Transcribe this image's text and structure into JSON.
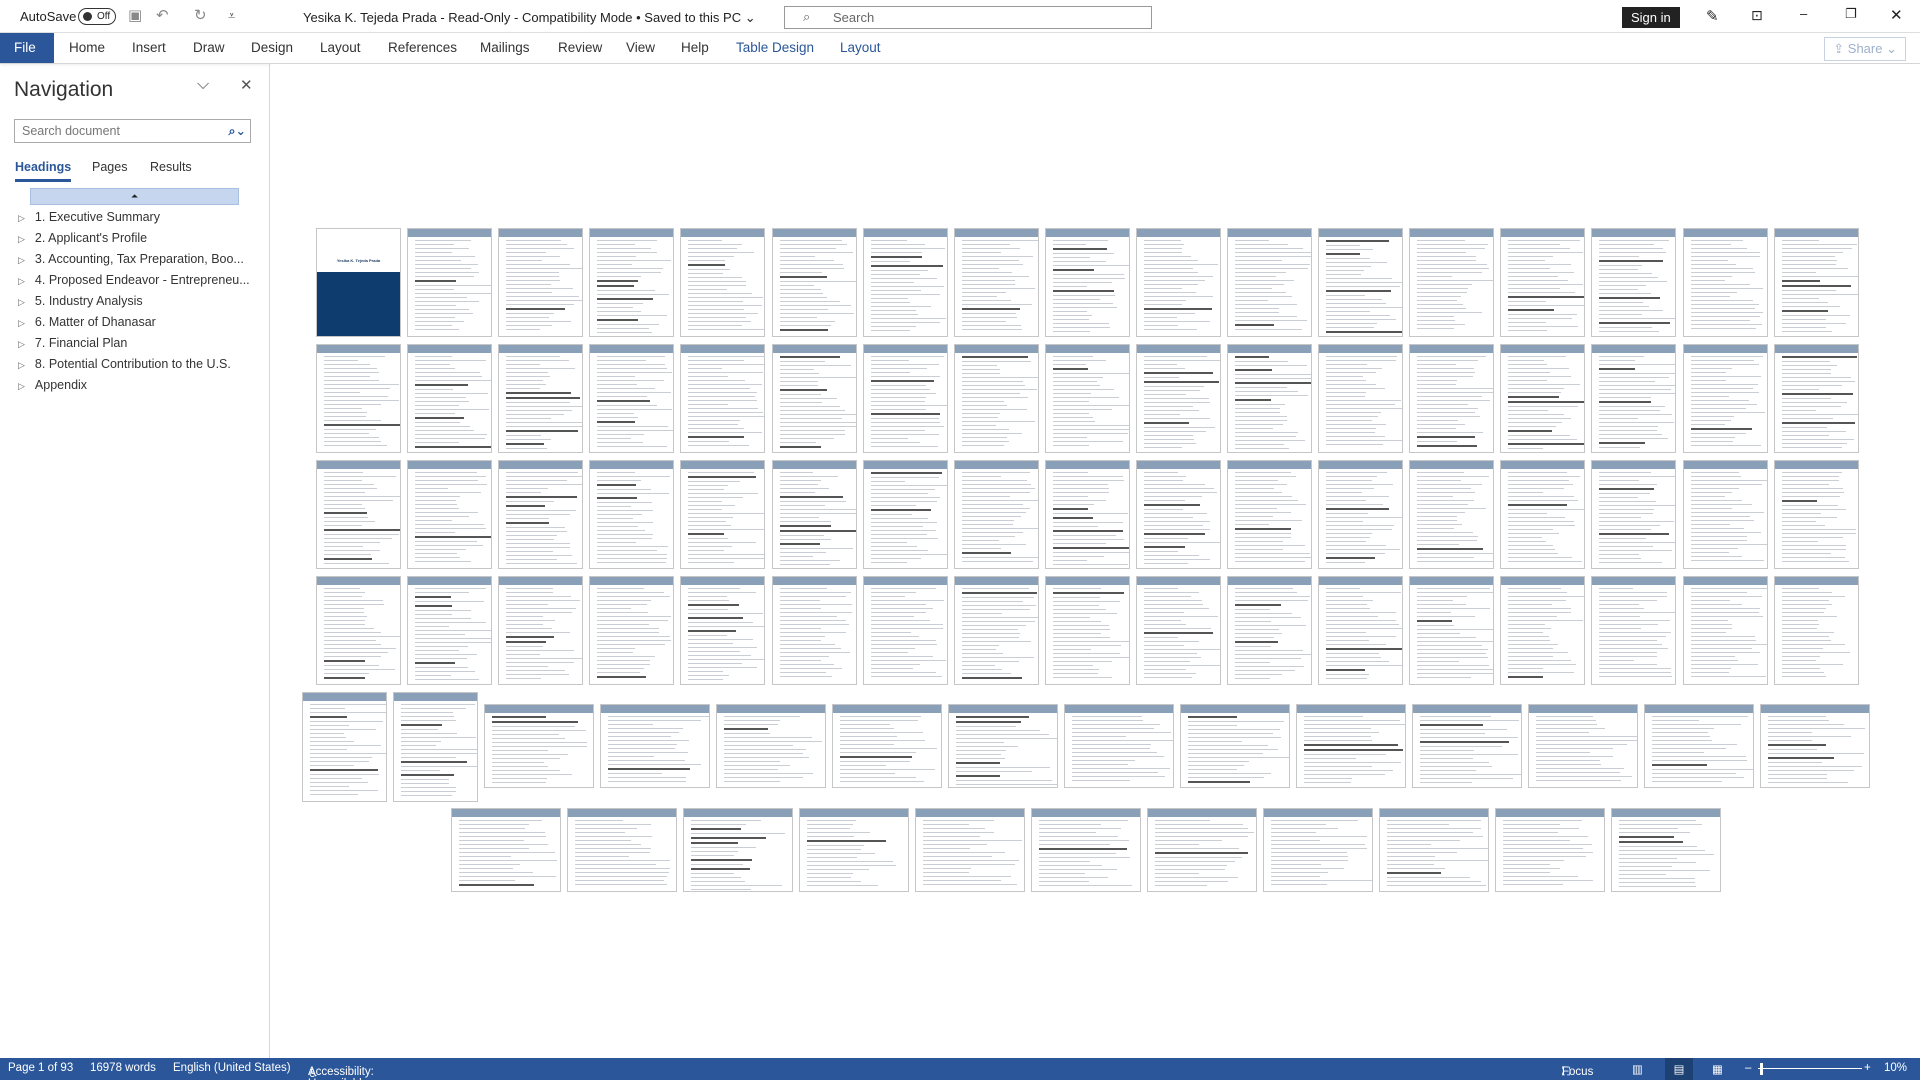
{
  "titlebar": {
    "autosave_label": "AutoSave",
    "autosave_state": "Off",
    "title": "Yesika K. Tejeda Prada  -  Read-Only  -  Compatibility Mode • Saved to this PC ⌄",
    "search_placeholder": "Search",
    "signin": "Sign in",
    "icons": [
      "save-icon",
      "undo-icon",
      "redo-icon",
      "customize-icon",
      "pen-icon",
      "ribbon-display-icon",
      "minimize-icon",
      "restore-icon",
      "close-icon"
    ]
  },
  "ribbon": {
    "tabs": [
      "File",
      "Home",
      "Insert",
      "Draw",
      "Design",
      "Layout",
      "References",
      "Mailings",
      "Review",
      "View",
      "Help",
      "Table Design",
      "Layout"
    ],
    "share": "Share"
  },
  "navigation": {
    "title": "Navigation",
    "search_placeholder": "Search document",
    "tabs": [
      "Headings",
      "Pages",
      "Results"
    ],
    "active_tab": "Headings",
    "headings": [
      "1. Executive Summary",
      "2. Applicant's Profile",
      "3. Accounting, Tax Preparation, Boo...",
      "4. Proposed Endeavor - Entrepreneu...",
      "5. Industry Analysis",
      "6. Matter of Dhanasar",
      "7. Financial Plan",
      "8. Potential Contribution to the U.S.",
      "Appendix"
    ]
  },
  "document": {
    "cover_name": "Yesika K. Tejeda Prada",
    "page_count": 93,
    "accent": "#2b579a"
  },
  "status": {
    "page": "Page 1 of 93",
    "words": "16978 words",
    "language": "English (United States)",
    "accessibility": "Accessibility: Unavailable",
    "focus": "Focus",
    "zoom": "10%"
  }
}
